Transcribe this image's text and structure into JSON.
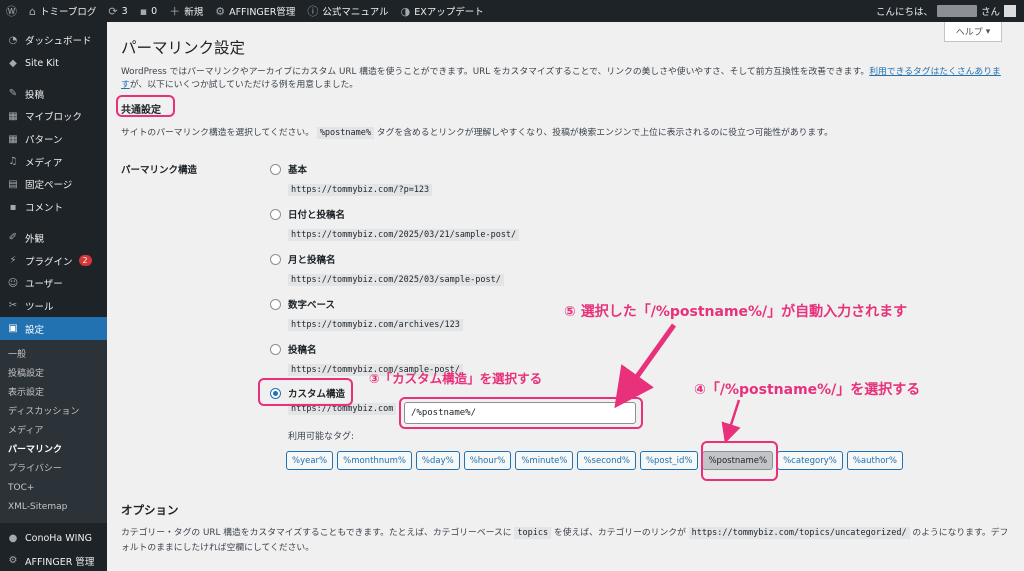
{
  "adminbar": {
    "site_name": "トミーブログ",
    "updates_count": "3",
    "comments_count": "0",
    "new_label": "新規",
    "affinger_label": "AFFINGER管理",
    "manual_label": "公式マニュアル",
    "ex_update_label": "EXアップデート",
    "greeting": "こんにちは、",
    "greeting_suffix": "さん"
  },
  "sidebar": {
    "items": [
      {
        "label": "ダッシュボード",
        "icon": "gauge-icon"
      },
      {
        "label": "Site Kit",
        "icon": "sitekit-icon"
      },
      {
        "label": "投稿",
        "icon": "pin-icon"
      },
      {
        "label": "マイブロック",
        "icon": "grid-icon"
      },
      {
        "label": "パターン",
        "icon": "grid-icon"
      },
      {
        "label": "メディア",
        "icon": "media-icon"
      },
      {
        "label": "固定ページ",
        "icon": "page-icon"
      },
      {
        "label": "コメント",
        "icon": "comment-icon"
      },
      {
        "label": "外観",
        "icon": "brush-icon"
      },
      {
        "label": "プラグイン",
        "icon": "plugin-icon",
        "badge": "2"
      },
      {
        "label": "ユーザー",
        "icon": "user-icon"
      },
      {
        "label": "ツール",
        "icon": "wrench-icon"
      },
      {
        "label": "設定",
        "icon": "settings-icon"
      }
    ],
    "submenu": [
      "一般",
      "投稿設定",
      "表示設定",
      "ディスカッション",
      "メディア",
      "パーマリンク",
      "プライバシー",
      "TOC+",
      "XML-Sitemap"
    ],
    "bottom_items": [
      {
        "label": "ConoHa WING",
        "icon": "conoha-icon"
      },
      {
        "label": "AFFINGER 管理",
        "icon": "affinger-icon"
      }
    ]
  },
  "help_tab": {
    "label": "ヘルプ"
  },
  "page": {
    "title": "パーマリンク設定",
    "intro_text": "WordPress ではパーマリンクやアーカイブにカスタム URL 構造を使うことができます。URL をカスタマイズすることで、リンクの美しさや使いやすさ、そして前方互換性を改善できます。",
    "intro_link": "利用できるタグはたくさんあります",
    "intro_tail": "が、以下にいくつか試していただける例を用意しました。",
    "common_heading": "共通設定",
    "common_desc_pre": "サイトのパーマリンク構造を選択してください。",
    "common_desc_code": "%postname%",
    "common_desc_post": "タグを含めるとリンクが理解しやすくなり、投稿が検索エンジンで上位に表示されるのに役立つ可能性があります。",
    "structure_label": "パーマリンク構造"
  },
  "options": [
    {
      "label": "基本",
      "example": "https://tommybiz.com/?p=123"
    },
    {
      "label": "日付と投稿名",
      "example": "https://tommybiz.com/2025/03/21/sample-post/"
    },
    {
      "label": "月と投稿名",
      "example": "https://tommybiz.com/2025/03/sample-post/"
    },
    {
      "label": "数字ベース",
      "example": "https://tommybiz.com/archives/123"
    },
    {
      "label": "投稿名",
      "example": "https://tommybiz.com/sample-post/"
    },
    {
      "label": "カスタム構造",
      "example": ""
    }
  ],
  "custom": {
    "prefix": "https://tommybiz.com",
    "value": "/%postname%/",
    "tags_label": "利用可能なタグ:"
  },
  "tags": [
    "%year%",
    "%monthnum%",
    "%day%",
    "%hour%",
    "%minute%",
    "%second%",
    "%post_id%",
    "%postname%",
    "%category%",
    "%author%"
  ],
  "options_section": {
    "heading": "オプション",
    "desc_pre": "カテゴリー・タグの URL 構造をカスタマイズすることもできます。たとえば、カテゴリーベースに",
    "desc_code1": "topics",
    "desc_mid": "を使えば、カテゴリーのリンクが",
    "desc_code2": "https://tommybiz.com/topics/uncategorized/",
    "desc_post": "のようになります。デフォルトのままにしたければ空欄にしてください。"
  },
  "annotations": {
    "step3": "③「カスタム構造」を選択する",
    "step4": "④「/%postname%/」を選択する",
    "step5": "⑤ 選択した「/%postname%/」が自動入力されます"
  },
  "colors": {
    "accent": "#2271b1",
    "annotation": "#e8317a",
    "adminbar": "#1d2327"
  }
}
